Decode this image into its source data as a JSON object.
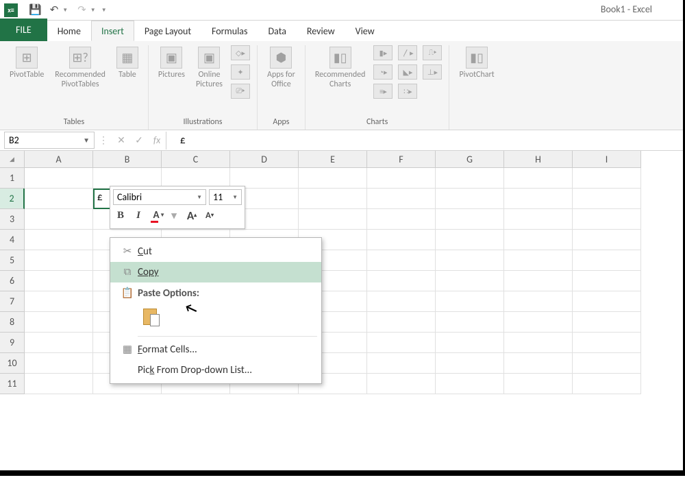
{
  "window_title": "Book1 - Excel",
  "tabs": {
    "file": "FILE",
    "home": "Home",
    "insert": "Insert",
    "page_layout": "Page Layout",
    "formulas": "Formulas",
    "data": "Data",
    "review": "Review",
    "view": "View"
  },
  "groups": {
    "tables": "Tables",
    "illustrations": "Illustrations",
    "apps": "Apps",
    "charts": "Charts"
  },
  "ribbon": {
    "pivottable": "PivotTable",
    "recommended_pivots": "Recommended\nPivotTables",
    "table": "Table",
    "pictures": "Pictures",
    "online_pictures": "Online\nPictures",
    "apps_for_office": "Apps for\nOffice",
    "recommended_charts": "Recommended\nCharts",
    "pivotchart": "PivotChart"
  },
  "namebox": "B2",
  "formula_value": "£",
  "active_cell_value": "£",
  "columns": [
    "A",
    "B",
    "C",
    "D",
    "E",
    "F",
    "G",
    "H",
    "I"
  ],
  "rows": [
    "1",
    "2",
    "3",
    "4",
    "5",
    "6",
    "7",
    "8",
    "9",
    "10",
    "11"
  ],
  "mini_toolbar": {
    "font": "Calibri",
    "size": "11",
    "bold": "B",
    "italic": "I",
    "font_color": "A",
    "grow": "A",
    "shrink": "A"
  },
  "context_menu": {
    "cut": "Cut",
    "copy": "Copy",
    "paste_options": "Paste Options:",
    "format_cells": "Format Cells...",
    "pick_list": "Pick From Drop-down List..."
  }
}
